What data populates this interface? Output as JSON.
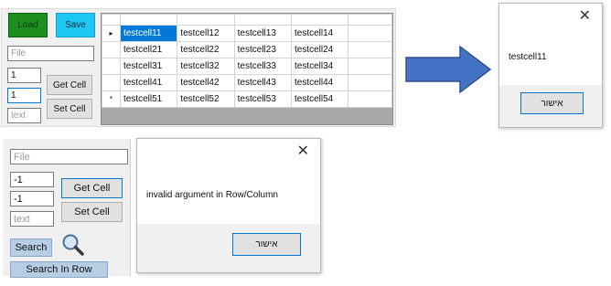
{
  "top_form": {
    "load_label": "Load",
    "save_label": "Save",
    "file_placeholder": "File",
    "row_value": "1",
    "col_value": "1",
    "text_placeholder": "text",
    "get_cell_label": "Get Cell",
    "set_cell_label": "Set Cell",
    "load_color": "#1e8f1e",
    "save_color": "#1ec8f5"
  },
  "grid": {
    "row_markers": [
      "▸",
      "",
      "",
      "",
      "*"
    ],
    "rows": [
      [
        "testcell11",
        "testcell12",
        "testcell13",
        "testcell14"
      ],
      [
        "testcell21",
        "testcell22",
        "testcell23",
        "testcell24"
      ],
      [
        "testcell31",
        "testcell32",
        "testcell33",
        "testcell34"
      ],
      [
        "testcell41",
        "testcell42",
        "testcell43",
        "testcell44"
      ],
      [
        "testcell51",
        "testcell52",
        "testcell53",
        "testcell54"
      ]
    ],
    "selected_color": "#0078d7"
  },
  "arrow": {
    "icon": "right-arrow-icon",
    "color": "#4472c4"
  },
  "dialog1": {
    "message": "testcell11",
    "ok_label": "אישור",
    "close_icon": "close-icon"
  },
  "bottom_form": {
    "file_placeholder": "File",
    "row_value": "-1",
    "col_value": "-1",
    "text_placeholder": "text",
    "get_cell_label": "Get Cell",
    "set_cell_label": "Set Cell",
    "search_label": "Search",
    "search_in_row_label": "Search In Row",
    "search_icon": "magnifier-icon"
  },
  "dialog2": {
    "message": "invalid argument in Row/Column",
    "ok_label": "אישור",
    "close_icon": "close-icon"
  }
}
